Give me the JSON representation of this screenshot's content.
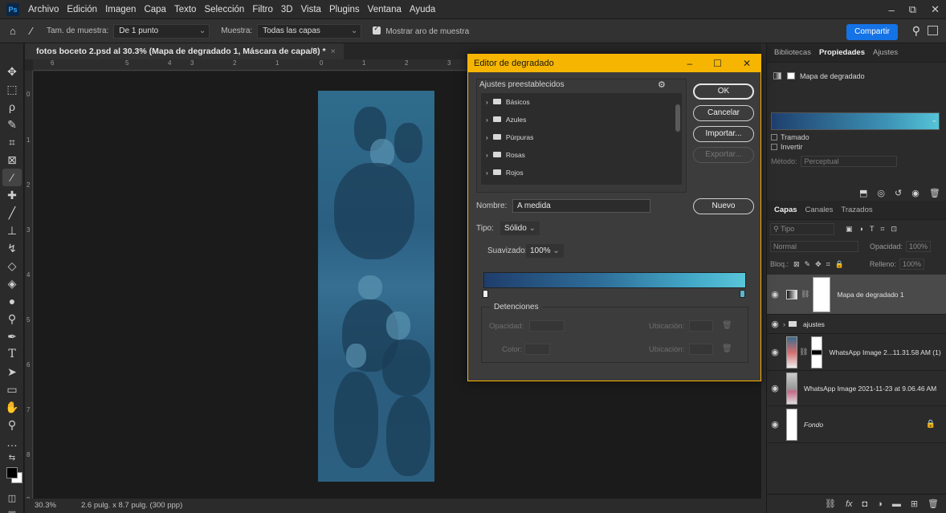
{
  "app": {
    "logo": "Ps"
  },
  "menu": [
    "Archivo",
    "Edición",
    "Imagen",
    "Capa",
    "Texto",
    "Selección",
    "Filtro",
    "3D",
    "Vista",
    "Plugins",
    "Ventana",
    "Ayuda"
  ],
  "window_controls": {
    "minimize": "–",
    "restore": "⧉",
    "close": "✕"
  },
  "options": {
    "sample_size_label": "Tam. de muestra:",
    "sample_size_value": "De 1 punto",
    "sample_label": "Muestra:",
    "sample_value": "Todas las capas",
    "show_ring_label": "Mostrar aro de muestra",
    "share_label": "Compartir"
  },
  "document": {
    "tab_title": "fotos boceto 2.psd al 30.3% (Mapa de degradado 1, Máscara de capa/8) *",
    "tab_close": "×",
    "zoom": "30.3%",
    "doc_info": "2.6 pulg. x 8.7 pulg. (300 ppp)",
    "ruler_h": [
      "6",
      "5",
      "4",
      "3",
      "2",
      "1",
      "0",
      "1",
      "2",
      "3"
    ],
    "ruler_v": [
      "0",
      "1",
      "2",
      "3",
      "4",
      "5",
      "6",
      "7",
      "8",
      "9"
    ]
  },
  "dialog": {
    "title": "Editor de degradado",
    "presets_title": "Ajustes preestablecidos",
    "presets": [
      "Básicos",
      "Azules",
      "Púrpuras",
      "Rosas",
      "Rojos"
    ],
    "ok": "OK",
    "cancel": "Cancelar",
    "import": "Importar...",
    "export": "Exportar...",
    "name_label": "Nombre:",
    "name_value": "A medida",
    "new": "Nuevo",
    "type_label": "Tipo:",
    "type_value": "Sólido",
    "smooth_label": "Suavizado:",
    "smooth_value": "100%",
    "stops_title": "Detenciones",
    "opacity_label": "Opacidad:",
    "location_label": "Ubicación:",
    "color_label": "Color:",
    "gradient_start": "#1f3d6c",
    "gradient_end": "#58c5d9"
  },
  "properties": {
    "tabs": [
      "Bibliotecas",
      "Propiedades",
      "Ajustes"
    ],
    "header": "Mapa de degradado",
    "dither": "Tramado",
    "reverse": "Invertir",
    "method_label": "Método:",
    "method_value": "Perceptual"
  },
  "layers": {
    "tabs": [
      "Capas",
      "Canales",
      "Trazados"
    ],
    "filter_placeholder": "Tipo",
    "blend_mode": "Normal",
    "opacity_label": "Opacidad:",
    "opacity_value": "100%",
    "lock_label": "Bloq.:",
    "fill_label": "Relleno:",
    "fill_value": "100%",
    "items": [
      {
        "name": "Mapa de degradado 1"
      },
      {
        "name": "ajustes"
      },
      {
        "name": "WhatsApp Image 2...11.31.58 AM (1)"
      },
      {
        "name": "WhatsApp Image 2021-11-23 at 9.06.46 AM"
      },
      {
        "name": "Fondo"
      }
    ]
  }
}
